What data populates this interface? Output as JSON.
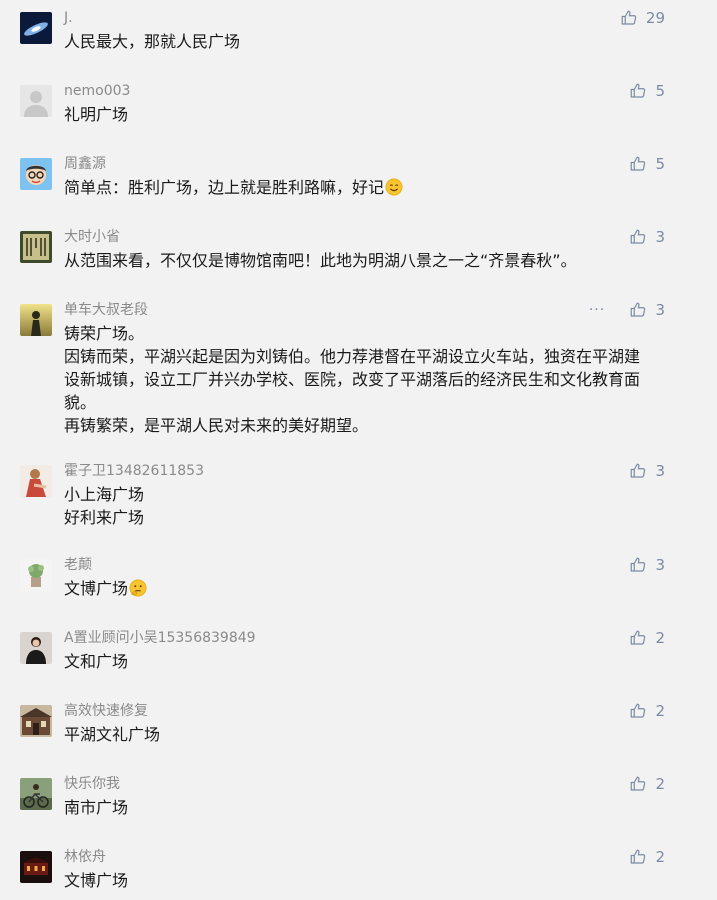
{
  "comments": [
    {
      "name": "J.",
      "text": [
        "人民最大，那就人民广场"
      ],
      "likes": "29",
      "avatar": "galaxy-avatar"
    },
    {
      "name": "nemo003",
      "text": [
        "礼明广场"
      ],
      "likes": "5",
      "avatar": "default-avatar"
    },
    {
      "name": "周鑫源",
      "text": [
        "简单点：胜利广场，边上就是胜利路嘛，好记"
      ],
      "emoji": "smiling-emoji",
      "likes": "5",
      "avatar": "cartoon-avatar"
    },
    {
      "name": "大时小省",
      "text": [
        "从范围来看，不仅仅是博物馆南吧！此地为明湖八景之一之“齐景春秋”。"
      ],
      "likes": "3",
      "avatar": "calligraphy-avatar"
    },
    {
      "name": "单车大叔老段",
      "text": [
        "铸荣广场。",
        "因铸而荣，平湖兴起是因为刘铸伯。他力荐港督在平湖设立火车站，独资在平湖建",
        "设新城镇，设立工厂并兴办学校、医院，改变了平湖落后的经济民生和文化教育面",
        "貌。",
        "再铸繁荣，是平湖人民对未来的美好期望。"
      ],
      "likes": "3",
      "avatar": "silhouette-avatar",
      "more": "···"
    },
    {
      "name": "霍子卫13482611853",
      "text": [
        "小上海广场",
        "好利来广场"
      ],
      "likes": "3",
      "avatar": "portrait-avatar"
    },
    {
      "name": "老颠",
      "text": [
        "文博广场"
      ],
      "emoji": "thinking-emoji",
      "likes": "3",
      "avatar": "plant-avatar"
    },
    {
      "name": "A置业顾问小吴15356839849",
      "text": [
        "文和广场"
      ],
      "likes": "2",
      "avatar": "woman-avatar"
    },
    {
      "name": "高效快速修复",
      "text": [
        "平湖文礼广场"
      ],
      "likes": "2",
      "avatar": "building-avatar"
    },
    {
      "name": "快乐你我",
      "text": [
        "南市广场"
      ],
      "likes": "2",
      "avatar": "bike-avatar"
    },
    {
      "name": "林依舟",
      "text": [
        "文博广场"
      ],
      "likes": "2",
      "avatar": "night-avatar"
    }
  ],
  "colors": {
    "background": "#f2f2f2",
    "name": "#8a8a8a",
    "text": "#1a1a1a",
    "like": "#7c8aa3"
  }
}
